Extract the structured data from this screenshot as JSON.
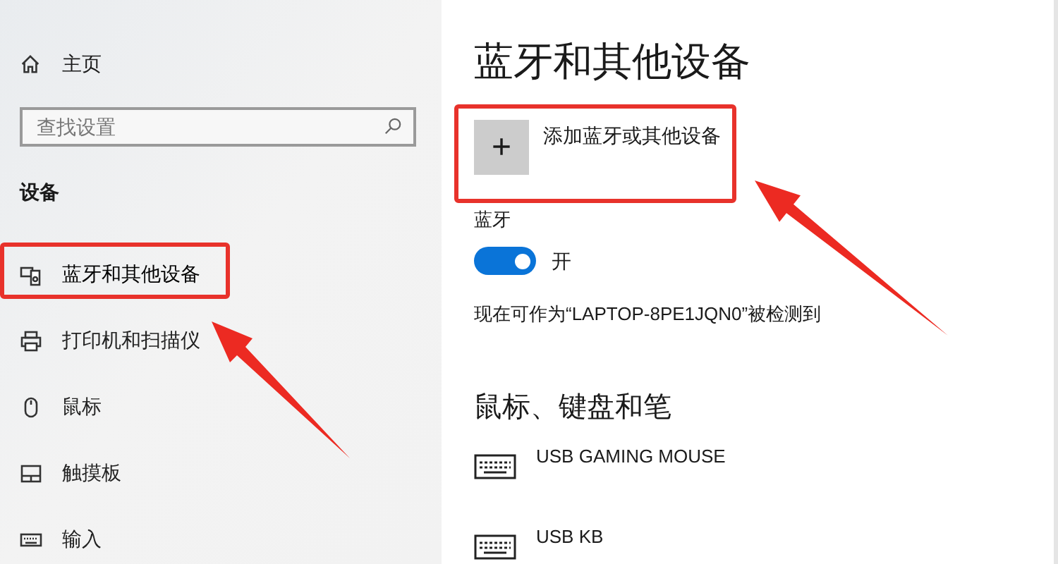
{
  "sidebar": {
    "home": {
      "label": "主页"
    },
    "search": {
      "placeholder": "查找设置"
    },
    "section_title": "设备",
    "items": [
      {
        "label": "蓝牙和其他设备",
        "kind": "devices",
        "selected": true
      },
      {
        "label": "打印机和扫描仪",
        "kind": "printer",
        "selected": false
      },
      {
        "label": "鼠标",
        "kind": "mouse",
        "selected": false
      },
      {
        "label": "触摸板",
        "kind": "touchpad",
        "selected": false
      },
      {
        "label": "输入",
        "kind": "keyboard",
        "selected": false
      }
    ]
  },
  "main": {
    "title": "蓝牙和其他设备",
    "add_button": {
      "icon": "+",
      "label": "添加蓝牙或其他设备"
    },
    "bluetooth": {
      "label": "蓝牙",
      "on": true,
      "state_label": "开"
    },
    "discoverable_text": "现在可作为“LAPTOP-8PE1JQN0”被检测到",
    "section_title": "鼠标、键盘和笔",
    "devices": [
      {
        "name": "USB GAMING MOUSE"
      },
      {
        "name": "USB KB"
      }
    ]
  }
}
